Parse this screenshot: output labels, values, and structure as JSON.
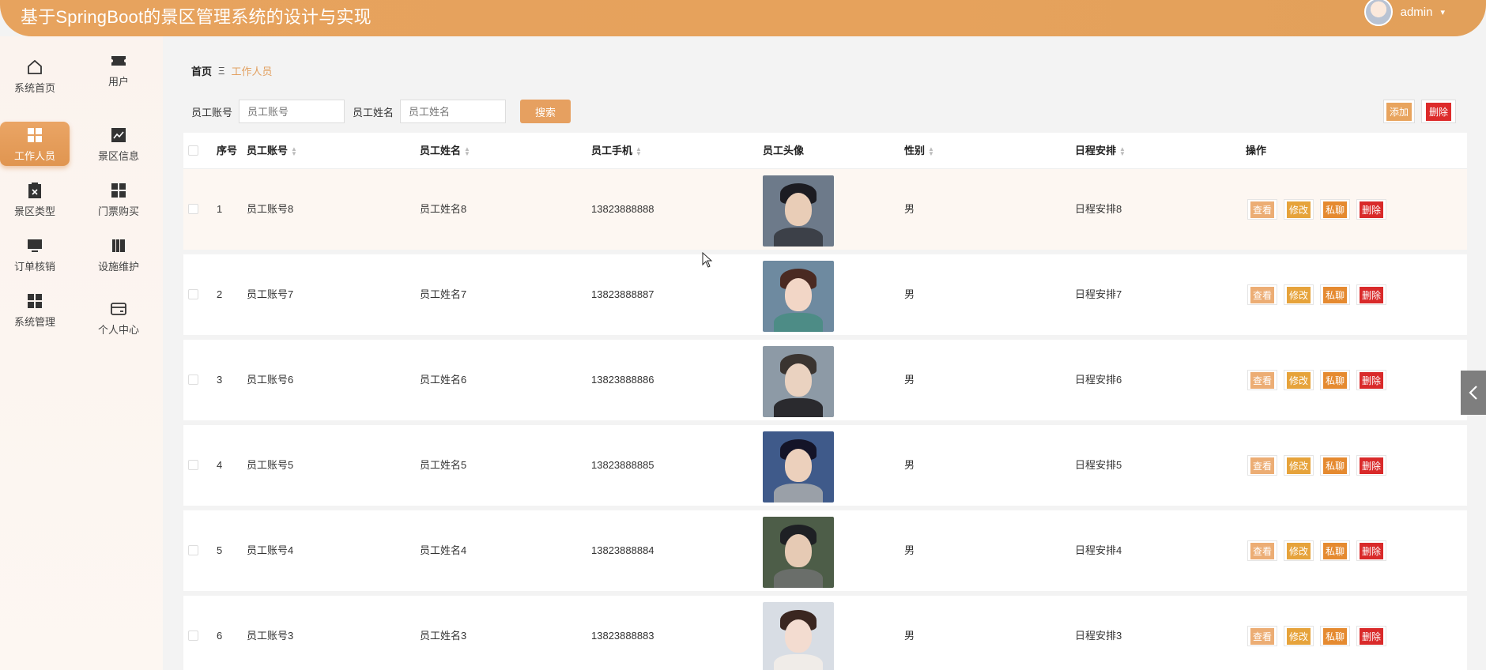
{
  "app": {
    "title": "基于SpringBoot的景区管理系统的设计与实现"
  },
  "user": {
    "name": "admin",
    "caret": "▾"
  },
  "sidebar": {
    "items": [
      {
        "label": "系统首页",
        "icon": "home-icon"
      },
      {
        "label": "用户",
        "icon": "ticket-icon"
      },
      {
        "label": "工作人员",
        "icon": "grid-icon",
        "active": true
      },
      {
        "label": "景区信息",
        "icon": "chart-icon"
      },
      {
        "label": "景区类型",
        "icon": "clipboard-icon"
      },
      {
        "label": "门票购买",
        "icon": "grid-icon"
      },
      {
        "label": "订单核销",
        "icon": "monitor-icon"
      },
      {
        "label": "设施维护",
        "icon": "book-icon"
      },
      {
        "label": "系统管理",
        "icon": "grid-icon"
      },
      {
        "label": "个人中心",
        "icon": "card-icon"
      }
    ]
  },
  "breadcrumb": {
    "home": "首页",
    "separator": "Ξ",
    "current": "工作人员"
  },
  "search": {
    "account_label": "员工账号",
    "account_placeholder": "员工账号",
    "name_label": "员工姓名",
    "name_placeholder": "员工姓名",
    "button": "搜索"
  },
  "actions": {
    "add": "添加",
    "delete": "删除"
  },
  "table": {
    "headers": {
      "index": "序号",
      "account": "员工账号",
      "name": "员工姓名",
      "phone": "员工手机",
      "avatar": "员工头像",
      "gender": "性别",
      "schedule": "日程安排",
      "ops": "操作"
    },
    "op_labels": {
      "view": "查看",
      "edit": "修改",
      "chat": "私聊",
      "delete": "删除"
    },
    "rows": [
      {
        "index": "1",
        "account": "员工账号8",
        "name": "员工姓名8",
        "phone": "13823888888",
        "gender": "男",
        "schedule": "日程安排8"
      },
      {
        "index": "2",
        "account": "员工账号7",
        "name": "员工姓名7",
        "phone": "13823888887",
        "gender": "男",
        "schedule": "日程安排7"
      },
      {
        "index": "3",
        "account": "员工账号6",
        "name": "员工姓名6",
        "phone": "13823888886",
        "gender": "男",
        "schedule": "日程安排6"
      },
      {
        "index": "4",
        "account": "员工账号5",
        "name": "员工姓名5",
        "phone": "13823888885",
        "gender": "男",
        "schedule": "日程安排5"
      },
      {
        "index": "5",
        "account": "员工账号4",
        "name": "员工姓名4",
        "phone": "13823888884",
        "gender": "男",
        "schedule": "日程安排4"
      },
      {
        "index": "6",
        "account": "员工账号3",
        "name": "员工姓名3",
        "phone": "13823888883",
        "gender": "男",
        "schedule": "日程安排3"
      }
    ]
  },
  "colors": {
    "header": "#e6a25c",
    "accent": "#e6a060",
    "danger": "#dd2b2b"
  }
}
